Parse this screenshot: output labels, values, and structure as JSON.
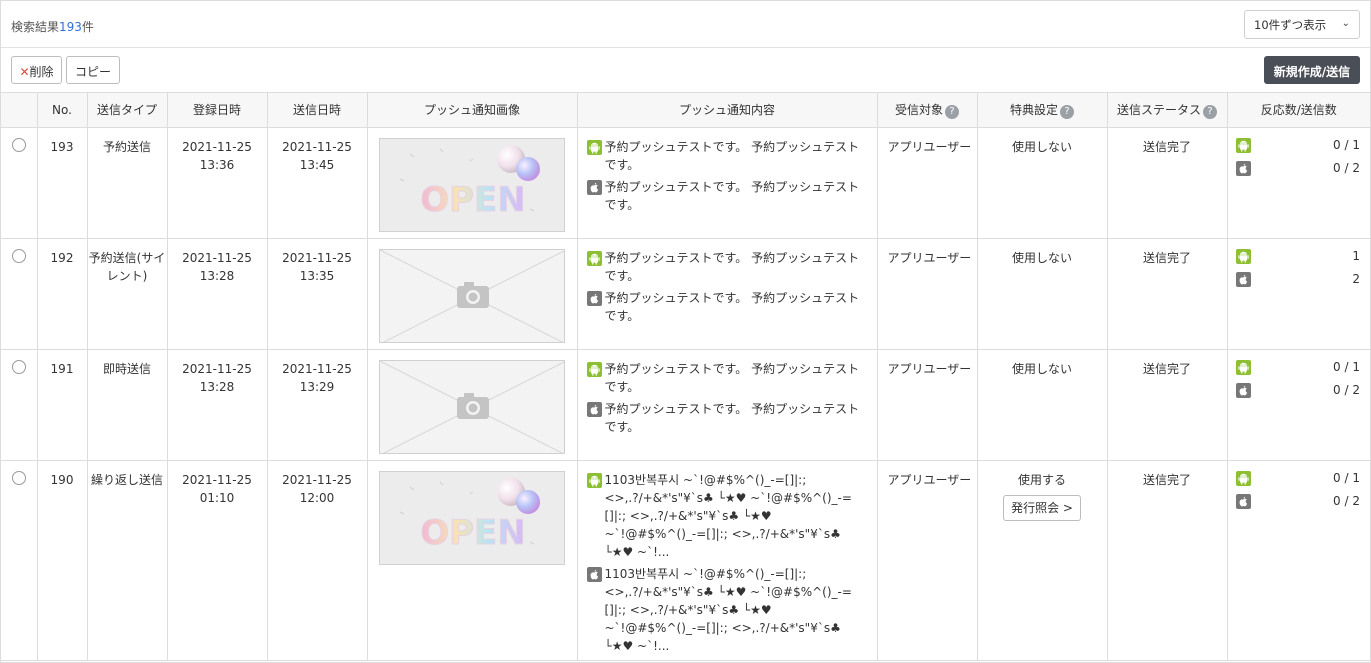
{
  "header": {
    "result_prefix": "検索結果",
    "result_count": "193",
    "result_suffix": "件",
    "per_page_selected": "10件ずつ表示"
  },
  "toolbar": {
    "delete_label": "削除",
    "copy_label": "コピー",
    "new_label": "新規作成/送信"
  },
  "table": {
    "columns": [
      "No.",
      "送信タイプ",
      "登録日時",
      "送信日時",
      "プッシュ通知画像",
      "プッシュ通知内容",
      "受信対象",
      "特典設定",
      "送信ステータス",
      "反応数/送信数"
    ],
    "rows": [
      {
        "no": "193",
        "type": "予約送信",
        "reg_date": "2021-11-25",
        "reg_time": "13:36",
        "send_date": "2021-11-25",
        "send_time": "13:45",
        "image": "open-image",
        "android_text": "予約プッシュテストです。 予約プッシュテストです。",
        "ios_text": "予約プッシュテストです。 予約プッシュテストです。",
        "target": "アプリユーザー",
        "benefit": "使用しない",
        "benefit_button": "",
        "status": "送信完了",
        "android_count": "0 / 1",
        "ios_count": "0 / 2"
      },
      {
        "no": "192",
        "type": "予約送信(サイレント)",
        "reg_date": "2021-11-25",
        "reg_time": "13:28",
        "send_date": "2021-11-25",
        "send_time": "13:35",
        "image": "placeholder",
        "android_text": "予約プッシュテストです。 予約プッシュテストです。",
        "ios_text": "予約プッシュテストです。 予約プッシュテストです。",
        "target": "アプリユーザー",
        "benefit": "使用しない",
        "benefit_button": "",
        "status": "送信完了",
        "android_count": "1",
        "ios_count": "2"
      },
      {
        "no": "191",
        "type": "即時送信",
        "reg_date": "2021-11-25",
        "reg_time": "13:28",
        "send_date": "2021-11-25",
        "send_time": "13:29",
        "image": "placeholder",
        "android_text": "予約プッシュテストです。 予約プッシュテストです。",
        "ios_text": "予約プッシュテストです。 予約プッシュテストです。",
        "target": "アプリユーザー",
        "benefit": "使用しない",
        "benefit_button": "",
        "status": "送信完了",
        "android_count": "0 / 1",
        "ios_count": "0 / 2"
      },
      {
        "no": "190",
        "type": "繰り返し送信",
        "reg_date": "2021-11-25",
        "reg_time": "01:10",
        "send_date": "2021-11-25",
        "send_time": "12:00",
        "image": "open-image",
        "android_text": "1103반복푸시 ~`!@#$%^()_-=[]|:; <>,.?/+&*'s\"¥`s♣ └★♥ ~`!@#$%^()_-=[]|:; <>,.?/+&*'s\"¥`s♣ └★♥ ~`!@#$%^()_-=[]|:; <>,.?/+&*'s\"¥`s♣ └★♥ ~`!...",
        "ios_text": "1103반복푸시 ~`!@#$%^()_-=[]|:; <>,.?/+&*'s\"¥`s♣ └★♥ ~`!@#$%^()_-=[]|:; <>,.?/+&*'s\"¥`s♣ └★♥ ~`!@#$%^()_-=[]|:; <>,.?/+&*'s\"¥`s♣ └★♥ ~`!...",
        "target": "アプリユーザー",
        "benefit": "使用する",
        "benefit_button": "発行照会 >",
        "status": "送信完了",
        "android_count": "0 / 1",
        "ios_count": "0 / 2"
      }
    ]
  },
  "open_image_text": "OPEN",
  "colors": {
    "accent_blue": "#2f6fd8",
    "android_green": "#8cbf32",
    "ios_gray": "#777777",
    "dark_button": "#4a4f57",
    "delete_red": "#e04a3a"
  }
}
